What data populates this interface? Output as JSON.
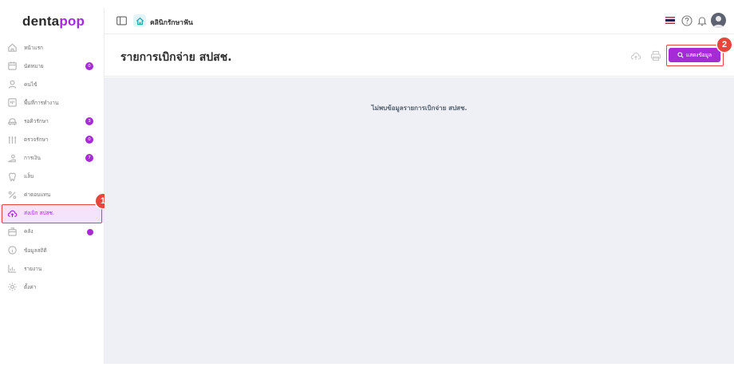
{
  "app": {
    "logo_part1": "denta",
    "logo_part2": "pop"
  },
  "topbar": {
    "clinic_name": "คลินิกรักษาฟัน"
  },
  "sidebar": {
    "items": [
      {
        "label": "หน้าแรก",
        "icon": "home-icon"
      },
      {
        "label": "นัดหมาย",
        "icon": "calendar-icon",
        "badge": "0"
      },
      {
        "label": "คนไข้",
        "icon": "user-icon"
      },
      {
        "label": "พื้นที่การทำงาน",
        "icon": "workspace-icon"
      },
      {
        "label": "รอคิวรักษา",
        "icon": "dental-chair-icon",
        "badge": "3"
      },
      {
        "label": "ตรวจรักษา",
        "icon": "dental-tools-icon",
        "badge": "0"
      },
      {
        "label": "การเงิน",
        "icon": "payment-icon",
        "badge": "7"
      },
      {
        "label": "แล็บ",
        "icon": "tooth-icon"
      },
      {
        "label": "ค่าตอบแทน",
        "icon": "percent-icon"
      },
      {
        "label": "ส่งเบิก สปสช.",
        "icon": "cloud-upload-icon",
        "active": true
      },
      {
        "label": "คลัง",
        "icon": "inventory-icon",
        "dot": true
      },
      {
        "label": "ข้อมูลสถิติ",
        "icon": "info-icon"
      },
      {
        "label": "รายงาน",
        "icon": "report-chart-icon"
      },
      {
        "label": "ตั้งค่า",
        "icon": "gear-icon"
      }
    ]
  },
  "content": {
    "title": "รายการเบิกจ่าย สปสช.",
    "show_button_label": "แสดงข้อมูล",
    "empty_message": "ไม่พบข้อมูลรายการเบิกจ่าย สปสช."
  },
  "annotations": {
    "marker1": "1",
    "marker2": "2"
  },
  "colors": {
    "accent": "#a52bd6",
    "highlight": "#e8453c"
  }
}
